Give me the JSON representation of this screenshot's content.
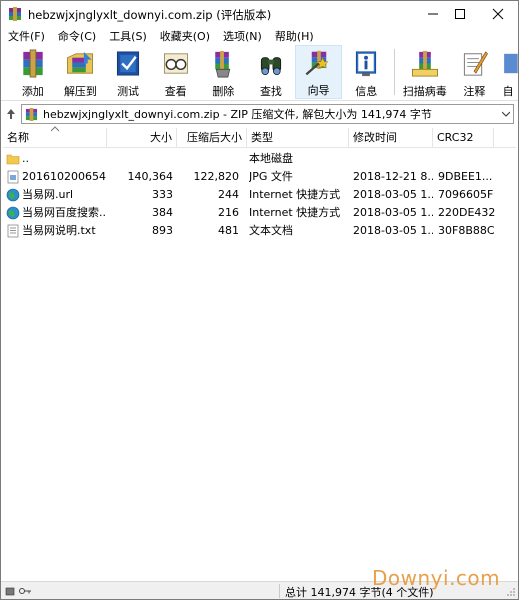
{
  "window": {
    "title": "hebzwjxjnglyxlt_downyi.com.zip (评估版本)"
  },
  "menu": [
    "文件(F)",
    "命令(C)",
    "工具(S)",
    "收藏夹(O)",
    "选项(N)",
    "帮助(H)"
  ],
  "toolbar": [
    {
      "label": "添加",
      "icon": "add-archive-icon"
    },
    {
      "label": "解压到",
      "icon": "extract-to-icon"
    },
    {
      "label": "测试",
      "icon": "test-icon"
    },
    {
      "label": "查看",
      "icon": "view-icon"
    },
    {
      "label": "删除",
      "icon": "delete-icon"
    },
    {
      "label": "查找",
      "icon": "find-icon"
    },
    {
      "label": "向导",
      "icon": "wizard-icon",
      "active": true
    },
    {
      "label": "信息",
      "icon": "info-icon"
    },
    {
      "label": "扫描病毒",
      "icon": "scan-virus-icon"
    },
    {
      "label": "注释",
      "icon": "comment-icon"
    },
    {
      "label": "自",
      "icon": "sfx-icon"
    }
  ],
  "address": {
    "text": "hebzwjxjnglyxlt_downyi.com.zip - ZIP 压缩文件, 解包大小为 141,974 字节"
  },
  "columns": [
    "名称",
    "大小",
    "压缩后大小",
    "类型",
    "修改时间",
    "CRC32"
  ],
  "files": [
    {
      "name": "..",
      "size": "",
      "packed": "",
      "type": "本地磁盘",
      "modified": "",
      "crc": "",
      "icon": "folder-icon"
    },
    {
      "name": "201610200654...",
      "size": "140,364",
      "packed": "122,820",
      "type": "JPG 文件",
      "modified": "2018-12-21 8...",
      "crc": "9DBEE1...",
      "icon": "image-file-icon"
    },
    {
      "name": "当易网.url",
      "size": "333",
      "packed": "244",
      "type": "Internet 快捷方式",
      "modified": "2018-03-05 1...",
      "crc": "7096605F",
      "icon": "globe-icon"
    },
    {
      "name": "当易网百度搜索...",
      "size": "384",
      "packed": "216",
      "type": "Internet 快捷方式",
      "modified": "2018-03-05 1...",
      "crc": "220DE432",
      "icon": "globe-icon"
    },
    {
      "name": "当易网说明.txt",
      "size": "893",
      "packed": "481",
      "type": "文本文档",
      "modified": "2018-03-05 1...",
      "crc": "30F8B88C",
      "icon": "text-file-icon"
    }
  ],
  "status": {
    "text": "总计 141,974 字节(4 个文件)"
  },
  "watermark": "Downyi.com"
}
